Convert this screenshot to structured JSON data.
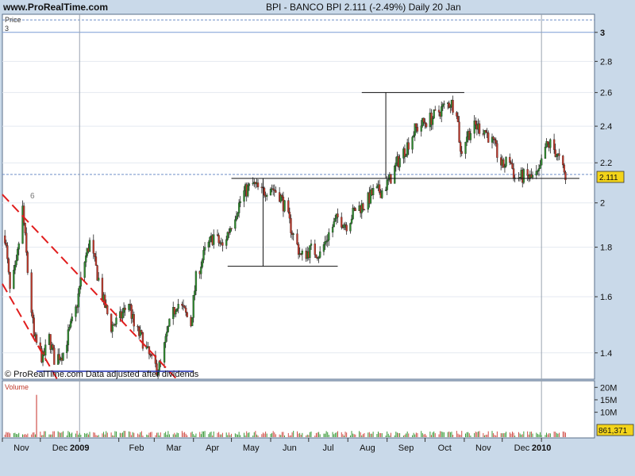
{
  "header": {
    "site": "www.ProRealTime.com",
    "title": "BPI - BANCO BPI    2.111 (-2.49%)    Daily  20 Jan"
  },
  "price_panel": {
    "label": "Price",
    "label_sub": "3",
    "copyright": "© ProRealTime.com  Data adjusted after dividends",
    "last_price_box": "2.111",
    "annotation_6": "6"
  },
  "volume_panel": {
    "label": "Volume",
    "last_volume_box": "861,371"
  },
  "colors": {
    "background": "#c9d9e9",
    "panel": "#ffffff",
    "up_candle": "#2e8b2e",
    "down_candle": "#c0392b",
    "channel": "#e11d1d",
    "support": "#1f2fb0",
    "price_box": "#f3d41a"
  },
  "chart_data": [
    {
      "type": "candlestick",
      "title": "BPI - BANCO BPI 2.111 (-2.49%) Daily 20 Jan",
      "y_scale": "log",
      "ylim": [
        1.32,
        3.12
      ],
      "y_ticks": [
        1.4,
        1.6,
        1.8,
        2,
        2.2,
        2.4,
        2.6,
        2.8,
        3
      ],
      "x_ticks": [
        "Nov",
        "Dec",
        "2009",
        "Feb",
        "Mar",
        "Apr",
        "May",
        "Jun",
        "Jul",
        "Aug",
        "Sep",
        "Oct",
        "Nov",
        "Dec",
        "2010"
      ],
      "grid": true,
      "close_path": [
        [
          "2008-11-03",
          1.85
        ],
        [
          "2008-11-07",
          1.62
        ],
        [
          "2008-11-12",
          1.72
        ],
        [
          "2008-11-17",
          1.97
        ],
        [
          "2008-11-21",
          1.7
        ],
        [
          "2008-11-26",
          1.45
        ],
        [
          "2008-12-03",
          1.38
        ],
        [
          "2008-12-08",
          1.45
        ],
        [
          "2008-12-12",
          1.38
        ],
        [
          "2008-12-19",
          1.4
        ],
        [
          "2008-12-29",
          1.55
        ],
        [
          "2009-01-05",
          1.74
        ],
        [
          "2009-01-09",
          1.82
        ],
        [
          "2009-01-14",
          1.71
        ],
        [
          "2009-01-20",
          1.58
        ],
        [
          "2009-01-26",
          1.49
        ],
        [
          "2009-02-02",
          1.52
        ],
        [
          "2009-02-09",
          1.58
        ],
        [
          "2009-02-13",
          1.49
        ],
        [
          "2009-02-19",
          1.45
        ],
        [
          "2009-02-27",
          1.37
        ],
        [
          "2009-03-03",
          1.35
        ],
        [
          "2009-03-06",
          1.36
        ],
        [
          "2009-03-12",
          1.48
        ],
        [
          "2009-03-19",
          1.58
        ],
        [
          "2009-03-24",
          1.55
        ],
        [
          "2009-03-30",
          1.5
        ],
        [
          "2009-04-03",
          1.67
        ],
        [
          "2009-04-10",
          1.78
        ],
        [
          "2009-04-17",
          1.85
        ],
        [
          "2009-04-24",
          1.8
        ],
        [
          "2009-05-04",
          1.95
        ],
        [
          "2009-05-11",
          2.05
        ],
        [
          "2009-05-18",
          2.09
        ],
        [
          "2009-05-25",
          2.05
        ],
        [
          "2009-06-01",
          2.08
        ],
        [
          "2009-06-08",
          2.04
        ],
        [
          "2009-06-12",
          1.98
        ],
        [
          "2009-06-19",
          1.85
        ],
        [
          "2009-06-25",
          1.76
        ],
        [
          "2009-07-03",
          1.79
        ],
        [
          "2009-07-10",
          1.77
        ],
        [
          "2009-07-17",
          1.86
        ],
        [
          "2009-07-24",
          1.93
        ],
        [
          "2009-07-31",
          1.9
        ],
        [
          "2009-08-07",
          1.97
        ],
        [
          "2009-08-14",
          1.99
        ],
        [
          "2009-08-21",
          2.05
        ],
        [
          "2009-08-28",
          2.06
        ],
        [
          "2009-09-03",
          2.11
        ],
        [
          "2009-09-09",
          2.2
        ],
        [
          "2009-09-16",
          2.28
        ],
        [
          "2009-09-23",
          2.38
        ],
        [
          "2009-09-30",
          2.42
        ],
        [
          "2009-10-07",
          2.45
        ],
        [
          "2009-10-14",
          2.5
        ],
        [
          "2009-10-21",
          2.54
        ],
        [
          "2009-10-26",
          2.5
        ],
        [
          "2009-10-29",
          2.25
        ],
        [
          "2009-11-03",
          2.35
        ],
        [
          "2009-11-10",
          2.4
        ],
        [
          "2009-11-17",
          2.38
        ],
        [
          "2009-11-24",
          2.3
        ],
        [
          "2009-12-01",
          2.18
        ],
        [
          "2009-12-07",
          2.22
        ],
        [
          "2009-12-11",
          2.12
        ],
        [
          "2009-12-18",
          2.13
        ],
        [
          "2009-12-24",
          2.12
        ],
        [
          "2009-12-30",
          2.14
        ],
        [
          "2010-01-04",
          2.28
        ],
        [
          "2010-01-08",
          2.3
        ],
        [
          "2010-01-13",
          2.25
        ],
        [
          "2010-01-18",
          2.16
        ],
        [
          "2010-01-20",
          2.111
        ]
      ],
      "annotations": [
        {
          "type": "channel_line",
          "color": "red",
          "dashed": true,
          "from": [
            "2008-11-01",
            2.04
          ],
          "to": [
            "2009-03-20",
            1.31
          ]
        },
        {
          "type": "channel_line",
          "color": "red",
          "dashed": true,
          "from": [
            "2008-11-01",
            1.65
          ],
          "to": [
            "2008-12-15",
            1.31
          ]
        },
        {
          "type": "support_line",
          "color": "blue",
          "from": [
            "2008-11-28",
            1.34
          ],
          "to": [
            "2009-04-01",
            1.34
          ]
        },
        {
          "type": "hline",
          "value": 2.12,
          "from": "2009-05-01",
          "to": "2010-01-31"
        },
        {
          "type": "hline",
          "value": 1.72,
          "from": "2009-04-28",
          "to": "2009-07-24"
        },
        {
          "type": "hline",
          "value": 2.6,
          "from": "2009-08-12",
          "to": "2009-11-01"
        },
        {
          "type": "vline",
          "at": "2009-05-26",
          "from": 1.72,
          "to": 2.12
        },
        {
          "type": "vline",
          "at": "2009-08-31",
          "from": 2.12,
          "to": 2.6
        }
      ]
    },
    {
      "type": "bar",
      "title": "Volume",
      "ylim": [
        0,
        22000000
      ],
      "y_ticks": [
        "10M",
        "15M",
        "20M"
      ],
      "spike": {
        "date": "2008-11-28",
        "value": 17000000
      },
      "typical_volume": 1500000,
      "last_value": 861371
    }
  ]
}
